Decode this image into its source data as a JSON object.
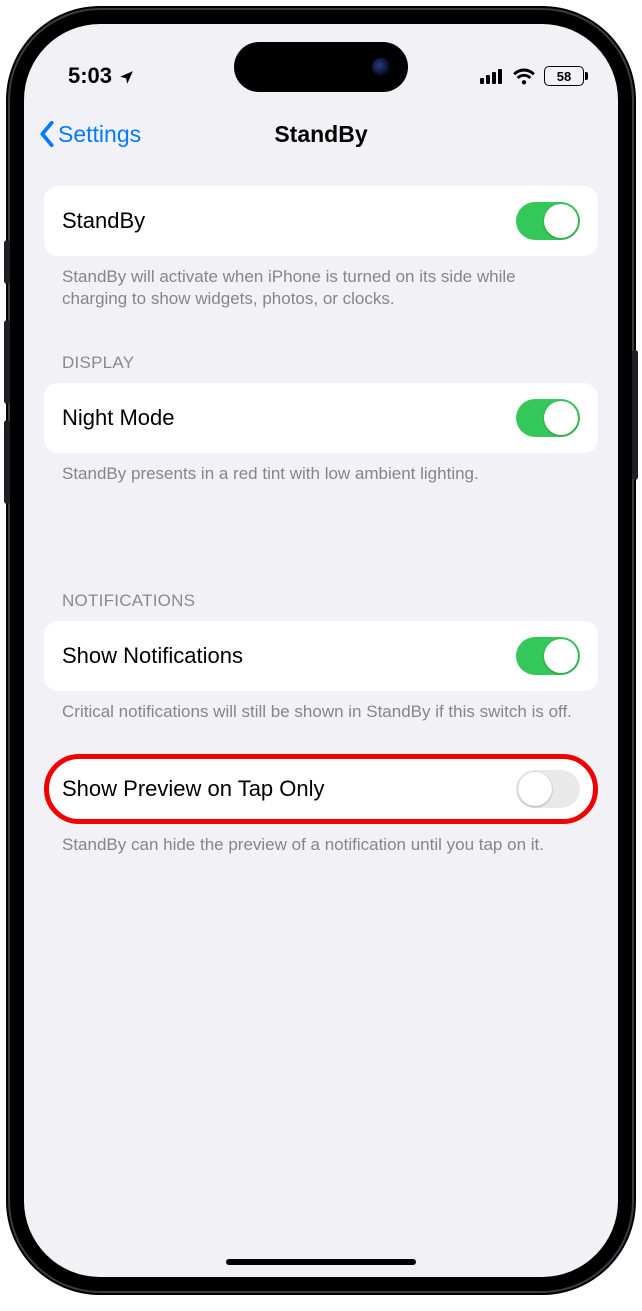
{
  "status": {
    "time": "5:03",
    "battery": "58"
  },
  "nav": {
    "back": "Settings",
    "title": "StandBy"
  },
  "groups": {
    "main": {
      "standby_label": "StandBy",
      "standby_on": true,
      "standby_help": "StandBy will activate when iPhone is turned on its side while charging to show widgets, photos, or clocks."
    },
    "display": {
      "header": "DISPLAY",
      "night_label": "Night Mode",
      "night_on": true,
      "night_help": "StandBy presents in a red tint with low ambient lighting."
    },
    "notifications": {
      "header": "NOTIFICATIONS",
      "show_label": "Show Notifications",
      "show_on": true,
      "show_help": "Critical notifications will still be shown in StandBy if this switch is off.",
      "preview_label": "Show Preview on Tap Only",
      "preview_on": false,
      "preview_help": "StandBy can hide the preview of a notification until you tap on it."
    }
  }
}
